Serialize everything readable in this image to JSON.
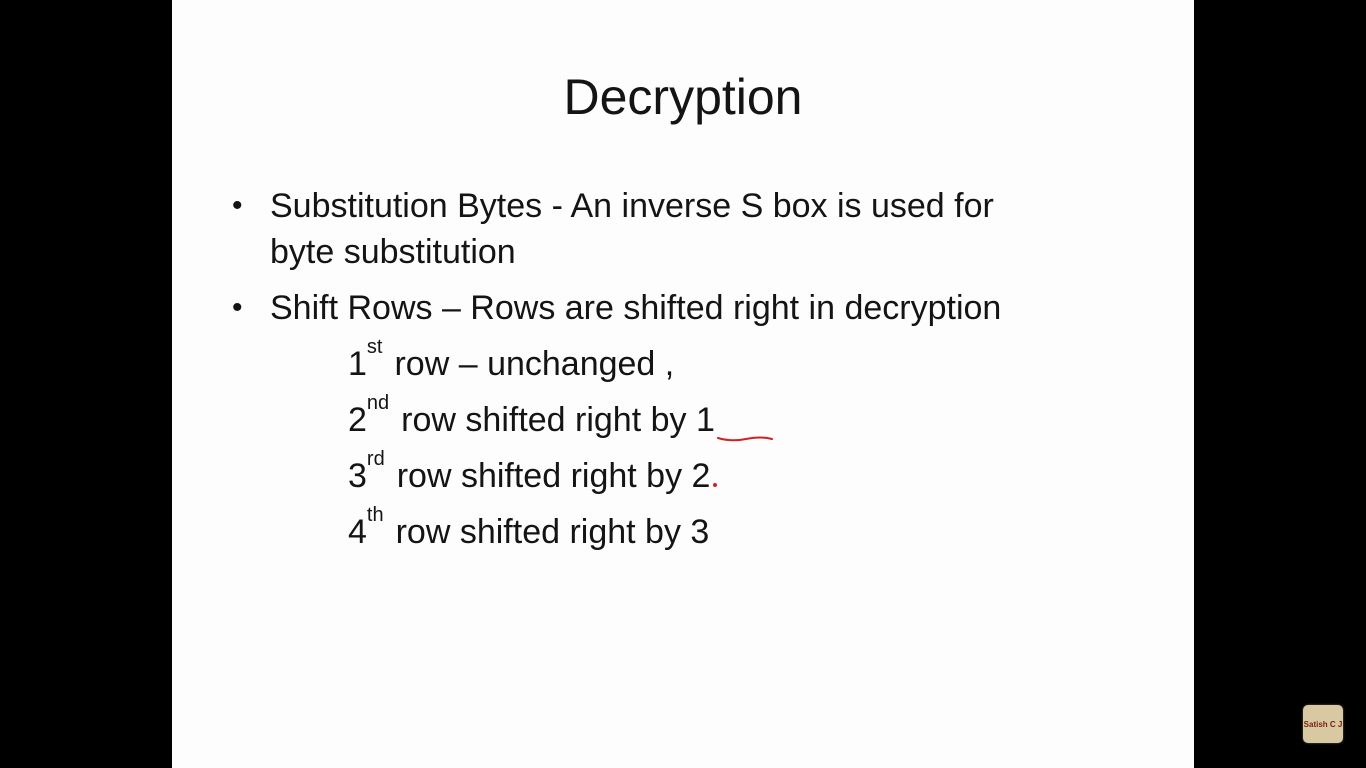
{
  "slide": {
    "title": "Decryption",
    "bullets": [
      {
        "line1": "Substitution Bytes  - An inverse S box is used for",
        "line2": "byte substitution"
      },
      {
        "line1": "Shift Rows – Rows are shifted right in decryption"
      }
    ],
    "bullet_char": "•",
    "shift_rows": [
      {
        "num": "1",
        "sup": "st",
        "text": "row – unchanged ,"
      },
      {
        "num": "2",
        "sup": "nd",
        "text": "row shifted right by 1"
      },
      {
        "num": "3",
        "sup": "rd",
        "text": "row shifted right by 2"
      },
      {
        "num": "4",
        "sup": "th",
        "text": "row shifted right by 3"
      }
    ]
  },
  "annotation_color": "#d42020",
  "watermark": {
    "text": "Satish C J"
  }
}
